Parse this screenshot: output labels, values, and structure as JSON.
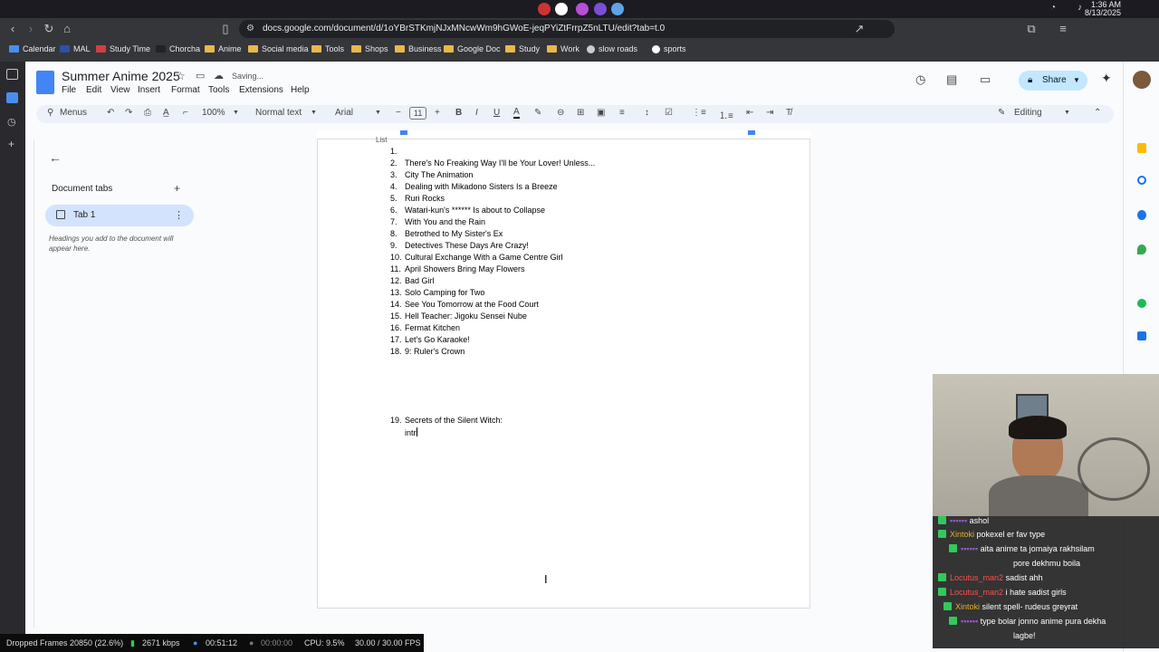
{
  "os": {
    "time": "1:36 AM",
    "date": "8/13/2025"
  },
  "browser": {
    "url": "docs.google.com/document/d/1oYBrSTKmjNJxMNcwWm9hGWoE-jeqPYiZtFrrpZ5nLTU/edit?tab=t.0",
    "bookmarks": [
      "Calendar",
      "MAL",
      "Study Time",
      "Chorcha",
      "Anime",
      "Social media",
      "Tools",
      "Shops",
      "Business",
      "Google Doc",
      "Study",
      "Work",
      "slow roads",
      "sports"
    ]
  },
  "docs": {
    "title": "Summer Anime 2025",
    "status": "Saving...",
    "menus": [
      "File",
      "Edit",
      "View",
      "Insert",
      "Format",
      "Tools",
      "Extensions",
      "Help"
    ],
    "share_label": "Share",
    "toolbar": {
      "search": "Menus",
      "zoom": "100%",
      "style": "Normal text",
      "font": "Arial",
      "font_size": "11",
      "mode": "Editing"
    },
    "outline": {
      "heading": "Document tabs",
      "tab_label": "Tab 1",
      "hint": "Headings you add to the document will appear here."
    },
    "page": {
      "partial_top": "List",
      "items": [
        {
          "n": "1.",
          "text": ""
        },
        {
          "n": "2.",
          "text": "There's No Freaking Way I'll be Your Lover! Unless..."
        },
        {
          "n": "3.",
          "text": "City The Animation"
        },
        {
          "n": "4.",
          "text": "Dealing with Mikadono Sisters Is a Breeze"
        },
        {
          "n": "5.",
          "text": "Ruri Rocks"
        },
        {
          "n": "6.",
          "text": "Watari-kun's ****** Is about to Collapse"
        },
        {
          "n": "7.",
          "text": "With You and the Rain"
        },
        {
          "n": "8.",
          "text": "Betrothed to My Sister's Ex"
        },
        {
          "n": "9.",
          "text": "Detectives These Days Are Crazy!"
        },
        {
          "n": "10.",
          "text": "Cultural Exchange With a Game Centre Girl"
        },
        {
          "n": "11.",
          "text": "April Showers Bring May Flowers"
        },
        {
          "n": "12.",
          "text": "Bad Girl"
        },
        {
          "n": "13.",
          "text": "Solo Camping for Two"
        },
        {
          "n": "14.",
          "text": "See You Tomorrow at the Food Court"
        },
        {
          "n": "15.",
          "text": "Hell Teacher: Jigoku Sensei Nube"
        },
        {
          "n": "16.",
          "text": "Fermat Kitchen"
        },
        {
          "n": "17.",
          "text": "Let's Go Karaoke!"
        },
        {
          "n": "18.",
          "text": "9: Ruler's Crown"
        }
      ],
      "item19": {
        "n": "19.",
        "text": "Secrets of the Silent Witch:"
      },
      "typing": "intr"
    }
  },
  "chat": [
    {
      "user": "",
      "text": "ashol"
    },
    {
      "user": "Xintoki",
      "text": "pokexel er fav type",
      "color": "#e0b22a"
    },
    {
      "user": "",
      "text": "aita anime ta jomaiya rakhsilam"
    },
    {
      "user": "",
      "text": "pore dekhmu boila"
    },
    {
      "user": "Locutus_man2",
      "text": "sadist ahh",
      "color": "#ff4d4d"
    },
    {
      "user": "Locutus_man2",
      "text": "i hate sadist girls",
      "color": "#ff4d4d"
    },
    {
      "user": "Xintoki",
      "text": "silent spell- rudeus greyrat",
      "color": "#e0b22a"
    },
    {
      "user": "",
      "text": "type bolar jonno anime pura dekha"
    },
    {
      "user": "",
      "text": "lagbe!"
    }
  ],
  "obs": {
    "dropped": "Dropped Frames 20850 (22.6%)",
    "kbps": "2671 kbps",
    "stream_time": "00:51:12",
    "rec_time": "00:00:00",
    "cpu": "CPU: 9.5%",
    "fps": "30.00 / 30.00 FPS"
  }
}
